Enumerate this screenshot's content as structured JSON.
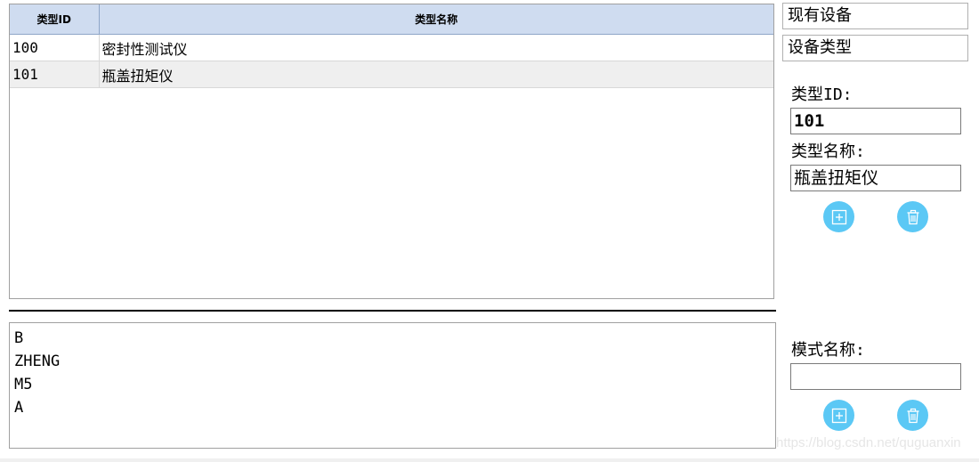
{
  "table": {
    "headers": [
      "类型ID",
      "类型名称"
    ],
    "rows": [
      {
        "id": "100",
        "name": "密封性测试仪"
      },
      {
        "id": "101",
        "name": "瓶盖扭矩仪"
      }
    ]
  },
  "list": [
    "B",
    "ZHENG",
    "M5",
    "A"
  ],
  "sidebar": {
    "existing_devices": "现有设备",
    "device_types": "设备类型"
  },
  "type_form": {
    "id_label": "类型ID:",
    "id_value": "101",
    "name_label": "类型名称:",
    "name_value": "瓶盖扭矩仪"
  },
  "mode_form": {
    "name_label": "模式名称:",
    "name_value": ""
  },
  "icons": {
    "add": "add-icon",
    "delete": "trash-icon",
    "button_color": "#5bc8f5"
  },
  "watermark": "https://blog.csdn.net/quguanxin"
}
